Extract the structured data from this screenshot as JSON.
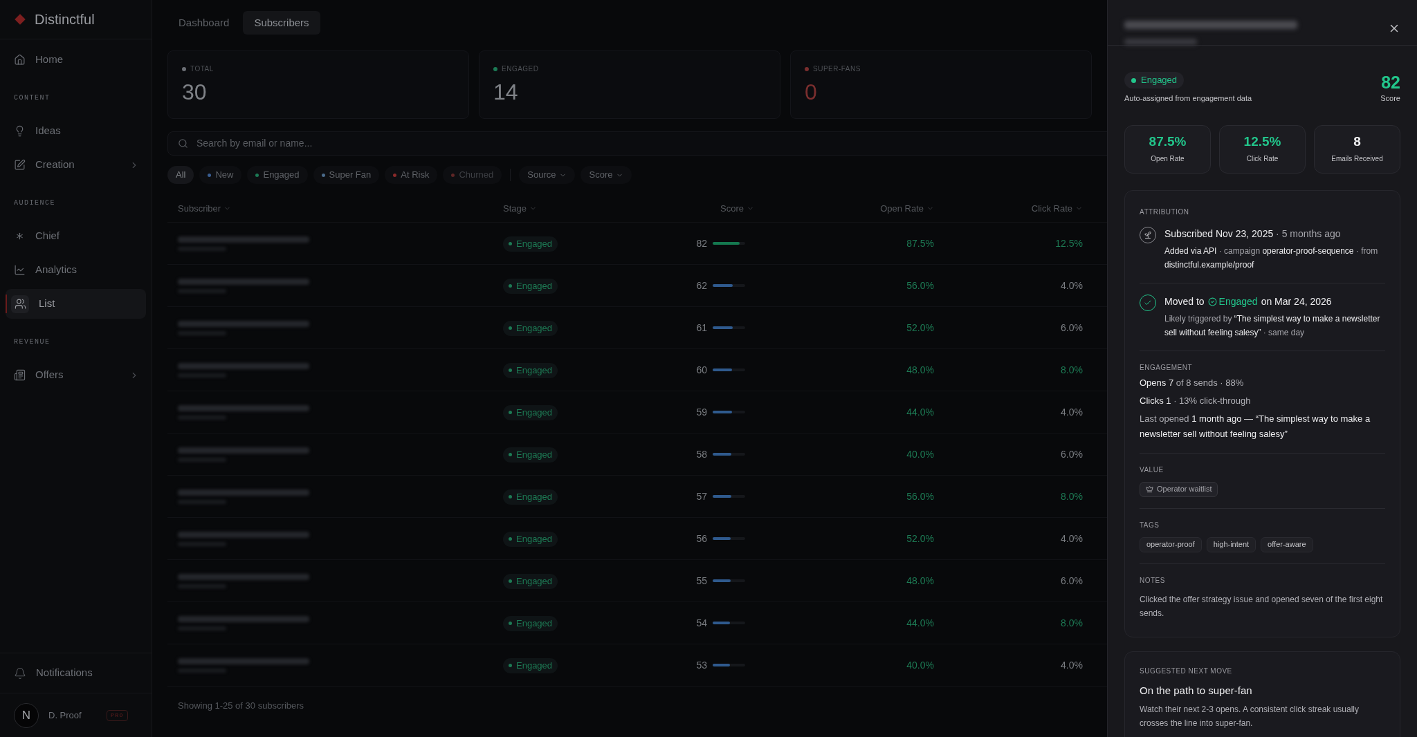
{
  "sidebar": {
    "brand": "Distinctful",
    "sections": [
      {
        "items": [
          {
            "label": "Home",
            "selected": false,
            "expandable": false
          }
        ]
      },
      {
        "heading": "CONTENT",
        "items": [
          {
            "label": "Ideas",
            "selected": false,
            "expandable": false
          },
          {
            "label": "Creation",
            "selected": false,
            "expandable": true
          }
        ]
      },
      {
        "heading": "AUDIENCE",
        "items": [
          {
            "label": "Chief",
            "selected": false,
            "expandable": false
          },
          {
            "label": "Analytics",
            "selected": false,
            "expandable": false
          },
          {
            "label": "List",
            "selected": true,
            "expandable": false
          }
        ]
      },
      {
        "heading": "REVENUE",
        "items": [
          {
            "label": "Offers",
            "selected": false,
            "expandable": true
          }
        ]
      }
    ],
    "notifications": "Notifications",
    "user": {
      "initial": "N",
      "name": "D. Proof",
      "badge": "PRO"
    }
  },
  "tabs": [
    {
      "label": "Dashboard",
      "selected": false
    },
    {
      "label": "Subscribers",
      "selected": true
    }
  ],
  "stats": [
    {
      "label": "TOTAL",
      "value": "30",
      "color": "#6b6e74"
    },
    {
      "label": "ENGAGED",
      "value": "14",
      "color": "#1c7a55"
    },
    {
      "label": "SUPER-FANS",
      "value": "0",
      "color": "#7a2e2e"
    }
  ],
  "search": {
    "placeholder": "Search by email or name..."
  },
  "filters": [
    {
      "label": "All",
      "selected": true,
      "disabled": false
    },
    {
      "label": "New",
      "color": "#3a5f94",
      "selected": false,
      "disabled": false
    },
    {
      "label": "Engaged",
      "color": "#1c7a55",
      "selected": false,
      "disabled": false
    },
    {
      "label": "Super Fan",
      "color": "#4a6a8a",
      "selected": false,
      "disabled": false
    },
    {
      "label": "At Risk",
      "color": "#8a2a2a",
      "selected": false,
      "disabled": false
    },
    {
      "label": "Churned",
      "color": "#5e2626",
      "selected": false,
      "disabled": true
    }
  ],
  "dropdowns": [
    "Source",
    "Score"
  ],
  "table": {
    "columns": [
      "Subscriber",
      "Stage",
      "Score",
      "Open Rate",
      "Click Rate"
    ],
    "rows": [
      {
        "stage": "Engaged",
        "score": "82",
        "level": 0.82,
        "color": "#14784f",
        "open_rate": "87.5%",
        "click_rate": "12.5%",
        "click_highlight": true
      },
      {
        "stage": "Engaged",
        "score": "62",
        "level": 0.62,
        "color": "#2f5a8e",
        "open_rate": "56.0%",
        "click_rate": "4.0%",
        "click_highlight": false
      },
      {
        "stage": "Engaged",
        "score": "61",
        "level": 0.61,
        "color": "#2f5a8e",
        "open_rate": "52.0%",
        "click_rate": "6.0%",
        "click_highlight": false
      },
      {
        "stage": "Engaged",
        "score": "60",
        "level": 0.6,
        "color": "#2f5a8e",
        "open_rate": "48.0%",
        "click_rate": "8.0%",
        "click_highlight": true
      },
      {
        "stage": "Engaged",
        "score": "59",
        "level": 0.59,
        "color": "#2f5a8e",
        "open_rate": "44.0%",
        "click_rate": "4.0%",
        "click_highlight": false
      },
      {
        "stage": "Engaged",
        "score": "58",
        "level": 0.58,
        "color": "#2f5a8e",
        "open_rate": "40.0%",
        "click_rate": "6.0%",
        "click_highlight": false
      },
      {
        "stage": "Engaged",
        "score": "57",
        "level": 0.57,
        "color": "#2f5a8e",
        "open_rate": "56.0%",
        "click_rate": "8.0%",
        "click_highlight": true
      },
      {
        "stage": "Engaged",
        "score": "56",
        "level": 0.56,
        "color": "#2f5a8e",
        "open_rate": "52.0%",
        "click_rate": "4.0%",
        "click_highlight": false
      },
      {
        "stage": "Engaged",
        "score": "55",
        "level": 0.55,
        "color": "#2f5a8e",
        "open_rate": "48.0%",
        "click_rate": "6.0%",
        "click_highlight": false
      },
      {
        "stage": "Engaged",
        "score": "54",
        "level": 0.54,
        "color": "#2f5a8e",
        "open_rate": "44.0%",
        "click_rate": "8.0%",
        "click_highlight": true
      },
      {
        "stage": "Engaged",
        "score": "53",
        "level": 0.53,
        "color": "#2f5a8e",
        "open_rate": "40.0%",
        "click_rate": "4.0%",
        "click_highlight": false
      }
    ],
    "footer": "Showing 1-25 of 30 subscribers"
  },
  "panel": {
    "stage": "Engaged",
    "stage_note": "Auto-assigned from engagement data",
    "score": {
      "value": "82",
      "label": "Score"
    },
    "metrics": [
      {
        "value": "87.5%",
        "label": "Open Rate",
        "highlight": true
      },
      {
        "value": "12.5%",
        "label": "Click Rate",
        "highlight": true
      },
      {
        "value": "8",
        "label": "Emails Received",
        "highlight": false
      }
    ],
    "attribution": {
      "heading": "ATTRIBUTION",
      "events": [
        {
          "kind": "subscribed",
          "title": "**Subscribed Nov 23, 2025** · 5 months ago",
          "detail": "**Added via API** · campaign **operator-proof-sequence** · from **distinctful.example/proof**"
        },
        {
          "kind": "stage",
          "prefix": "Moved to",
          "stage": "Engaged",
          "suffix": "on Mar 24, 2026",
          "detail": "Likely triggered by **“The simplest way to make a newsletter sell without feeling salesy”** · same day"
        }
      ]
    },
    "engagement": {
      "heading": "ENGAGEMENT",
      "lines": [
        "**Opens 7** of 8 sends · 88%",
        "**Clicks 1** · 13% click-through",
        "Last opened **1 month ago — “The simplest way to make a newsletter sell without feeling salesy”**"
      ]
    },
    "value": {
      "heading": "VALUE",
      "chip": "Operator waitlist"
    },
    "tags": {
      "heading": "TAGS",
      "items": [
        "operator-proof",
        "high-intent",
        "offer-aware"
      ]
    },
    "notes": {
      "heading": "NOTES",
      "text": "Clicked the offer strategy issue and opened seven of the first eight sends."
    },
    "suggestion": {
      "heading": "SUGGESTED NEXT MOVE",
      "title": "On the path to super-fan",
      "text": "Watch their next 2-3 opens. A consistent click streak usually crosses the line into super-fan."
    }
  }
}
